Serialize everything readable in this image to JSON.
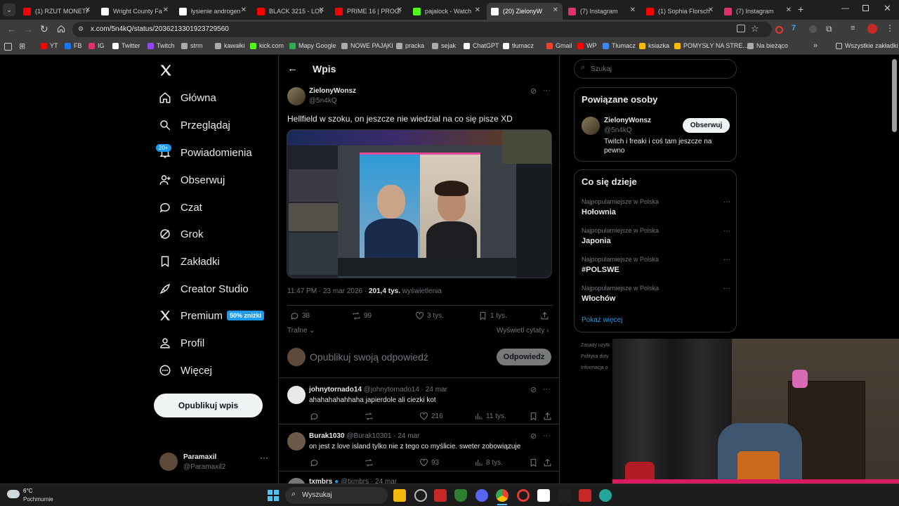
{
  "browser": {
    "tabs": [
      {
        "title": "(1) RZUT MONETĄ",
        "color": "#ff0000"
      },
      {
        "title": "Wright County Fa",
        "color": "#ffffff"
      },
      {
        "title": "łysienie androgen",
        "color": "#ffffff"
      },
      {
        "title": "BLACK 3215 - LOW",
        "color": "#ff0000"
      },
      {
        "title": "PRIME 16 | PROGR",
        "color": "#ff0000"
      },
      {
        "title": "pajalock - Watch",
        "color": "#53fc18"
      },
      {
        "title": "(20) ZielonyW",
        "color": "#ffffff",
        "active": true
      },
      {
        "title": "(7) Instagram",
        "color": "#e1306c"
      },
      {
        "title": "(1) Sophia Florsch",
        "color": "#ff0000"
      },
      {
        "title": "(7) Instagram",
        "color": "#e1306c"
      }
    ],
    "url": "x.com/5n4kQ/status/2036213301923729560",
    "bookmarks": [
      {
        "label": "YT",
        "color": "#ff0000"
      },
      {
        "label": "FB",
        "color": "#1877f2"
      },
      {
        "label": "IG",
        "color": "#e1306c"
      },
      {
        "label": "Twitter",
        "color": "#ffffff"
      },
      {
        "label": "Twitch",
        "color": "#9146ff"
      },
      {
        "label": "strm",
        "color": "#aaaaaa"
      },
      {
        "label": "kawałki",
        "color": "#aaaaaa"
      },
      {
        "label": "kick.com",
        "color": "#53fc18"
      },
      {
        "label": "Mapy Google",
        "color": "#34a853"
      },
      {
        "label": "NOWE PAJĄKI",
        "color": "#aaaaaa"
      },
      {
        "label": "pracka",
        "color": "#aaaaaa"
      },
      {
        "label": "sejak",
        "color": "#aaaaaa"
      },
      {
        "label": "ChatGPT",
        "color": "#ffffff"
      },
      {
        "label": "tłumacz",
        "color": "#ffffff"
      },
      {
        "label": "Gmail",
        "color": "#ea4335"
      },
      {
        "label": "WP",
        "color": "#ff0000"
      },
      {
        "label": "Tłumacz",
        "color": "#4285f4"
      },
      {
        "label": "ksiazka",
        "color": "#fbbc04"
      },
      {
        "label": "POMYSŁY NA STRE...",
        "color": "#fbbc04"
      },
      {
        "label": "Na bieżąco",
        "color": "#aaaaaa"
      }
    ],
    "all_bookmarks": "Wszystkie zakładki"
  },
  "sidebar": {
    "items": [
      {
        "label": "Główna",
        "icon": "home-icon"
      },
      {
        "label": "Przeglądaj",
        "icon": "search-icon"
      },
      {
        "label": "Powiadomienia",
        "icon": "bell-icon",
        "badge": "20+"
      },
      {
        "label": "Obserwuj",
        "icon": "person-add-icon"
      },
      {
        "label": "Czat",
        "icon": "chat-icon"
      },
      {
        "label": "Grok",
        "icon": "grok-icon"
      },
      {
        "label": "Zakładki",
        "icon": "bookmark-icon"
      },
      {
        "label": "Creator Studio",
        "icon": "rocket-icon"
      },
      {
        "label": "Premium",
        "icon": "x-logo-icon",
        "badge": "50% zniżki"
      },
      {
        "label": "Profil",
        "icon": "person-icon"
      },
      {
        "label": "Więcej",
        "icon": "more-circle-icon"
      }
    ],
    "post_button": "Opublikuj wpis",
    "account": {
      "name": "Paramaxil",
      "handle": "@Paramaxil2"
    }
  },
  "post": {
    "header": "Wpis",
    "author": "ZielonyWonsz",
    "handle": "@5n4kQ",
    "text": "Hellfield w szoku, on jeszcze nie wiedzial na co się pisze XD",
    "timestamp": "11:47 PM · 23 mar 2026 · ",
    "views_count": "201,4 tys.",
    "views_label": " wyświetlenia",
    "stats": {
      "replies": "38",
      "reposts": "99",
      "likes": "3 tys.",
      "bookmarks": "1 tys."
    },
    "sort": "Trafne",
    "quotes": "Wyświetl cytaty",
    "reply_placeholder": "Opublikuj swoją odpowiedź",
    "reply_button": "Odpowiedz"
  },
  "replies": [
    {
      "name": "johnytornado14",
      "handle": "@johnytornado14",
      "date": "· 24 mar",
      "text": "ahahahahahhaha japierdole ali ciezki kot",
      "likes": "216",
      "views": "11 tys."
    },
    {
      "name": "Burak1030",
      "handle": "@Burak10301",
      "date": "· 24 mar",
      "text": "on jest z love island tylko nie z tego co myślicie. sweter zobowiązuje",
      "likes": "93",
      "views": "8 tys."
    },
    {
      "name": "txmbrs",
      "handle": "@txmbrs",
      "date": "· 24 mar"
    }
  ],
  "right": {
    "search_placeholder": "Szukaj",
    "related_title": "Powiązane osoby",
    "related": {
      "name": "ZielonyWonsz",
      "handle": "@5n4kQ",
      "bio": "Twitch i freaki i coś tam jeszcze na pewno",
      "follow": "Obserwuj"
    },
    "trends_title": "Co się dzieje",
    "trends": [
      {
        "category": "Najpopularniejsze w Polska",
        "name": "Hołownia"
      },
      {
        "category": "Najpopularniejsze w Polska",
        "name": "Japonia"
      },
      {
        "category": "Najpopularniejsze w Polska",
        "name": "#POLSWE"
      },
      {
        "category": "Najpopularniejsze w Polska",
        "name": "Włochów"
      }
    ],
    "show_more": "Pokaż więcej",
    "footer": [
      "Zasady użytk",
      "Polityka doty",
      "Informacja o"
    ]
  },
  "taskbar": {
    "weather_temp": "6°C",
    "weather_desc": "Pochmurnie",
    "search_placeholder": "Wyszukaj"
  },
  "colors": {
    "accent": "#1d9bf0",
    "bg": "#000000",
    "border": "#2f3336",
    "muted": "#71767b"
  }
}
